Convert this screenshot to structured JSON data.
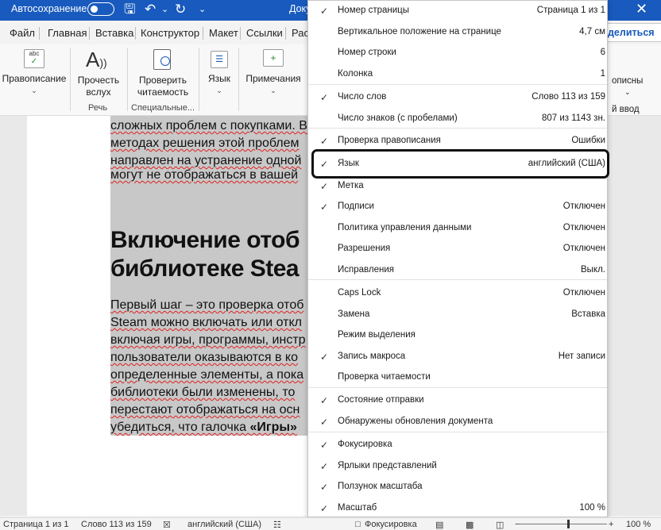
{
  "titlebar": {
    "autosave_label": "Автосохранение",
    "doc_title": "Доку"
  },
  "tabs": [
    "Файл",
    "Главная",
    "Вставка",
    "Конструктор",
    "Макет",
    "Ссылки",
    "Рас"
  ],
  "share_label": "делиться",
  "ribbon": {
    "spelling": "Правописание",
    "read_aloud": [
      "Прочесть",
      "вслух"
    ],
    "check_readability": [
      "Проверить",
      "читаемость"
    ],
    "language": "Язык",
    "comments": "Примечания",
    "group_speech": "Речь",
    "group_special": "Специальные...",
    "right_frag1": "описны",
    "right_frag2": "й ввод"
  },
  "document": {
    "lines_top": [
      "сложных проблем с покупками. В",
      "методах решения этой проблем",
      "направлен на устранение одной",
      "могут не отображаться в вашей"
    ],
    "heading": [
      "Включение отоб",
      "библиотеке Stea"
    ],
    "para": [
      "Первый шаг – это проверка отоб",
      "Steam можно включать или откл",
      "включая игры, программы, инстр",
      "пользователи оказываются в ко",
      "определенные элементы, а пока",
      "библиотеки были изменены, то",
      "перестают отображаться на осн"
    ],
    "last_line_pre": "убедиться, что галочка ",
    "last_line_bold": "«Игры»"
  },
  "menu": {
    "items": [
      {
        "check": "✓",
        "label": "Номер страницы",
        "value": "Страница 1 из 1"
      },
      {
        "check": "",
        "label": "Вертикальное положение на странице",
        "value": "4,7 см"
      },
      {
        "check": "",
        "label": "Номер строки",
        "value": "6"
      },
      {
        "check": "",
        "label": "Колонка",
        "value": "1"
      },
      {
        "check": "✓",
        "label": "Число слов",
        "value": "Слово 113 из 159"
      },
      {
        "check": "",
        "label": "Число знаков (с пробелами)",
        "value": "807 из 1143 зн."
      },
      {
        "check": "✓",
        "label": "Проверка правописания",
        "value": "Ошибки"
      },
      {
        "check": "✓",
        "label": "Язык",
        "value": "английский (США)"
      },
      {
        "check": "✓",
        "label": "Метка",
        "value": ""
      },
      {
        "check": "✓",
        "label": "Подписи",
        "value": "Отключен"
      },
      {
        "check": "",
        "label": "Политика управления данными",
        "value": "Отключен"
      },
      {
        "check": "",
        "label": "Разрешения",
        "value": "Отключен"
      },
      {
        "check": "",
        "label": "Исправления",
        "value": "Выкл."
      },
      {
        "check": "",
        "label": "Caps Lock",
        "value": "Отключен"
      },
      {
        "check": "",
        "label": "Замена",
        "value": "Вставка"
      },
      {
        "check": "",
        "label": "Режим выделения",
        "value": ""
      },
      {
        "check": "✓",
        "label": "Запись макроса",
        "value": "Нет записи"
      },
      {
        "check": "",
        "label": "Проверка читаемости",
        "value": ""
      },
      {
        "check": "✓",
        "label": "Состояние отправки",
        "value": ""
      },
      {
        "check": "✓",
        "label": "Обнаружены обновления документа",
        "value": ""
      },
      {
        "check": "✓",
        "label": "Фокусировка",
        "value": ""
      },
      {
        "check": "✓",
        "label": "Ярлыки представлений",
        "value": ""
      },
      {
        "check": "✓",
        "label": "Ползунок масштаба",
        "value": ""
      },
      {
        "check": "✓",
        "label": "Масштаб",
        "value": "100 %"
      }
    ]
  },
  "statusbar": {
    "page": "Страница 1 из 1",
    "words": "Слово 113 из 159",
    "language": "английский (США)",
    "focus": "Фокусировка",
    "zoom_minus": "−",
    "zoom_plus": "+",
    "zoom": "100 %"
  }
}
